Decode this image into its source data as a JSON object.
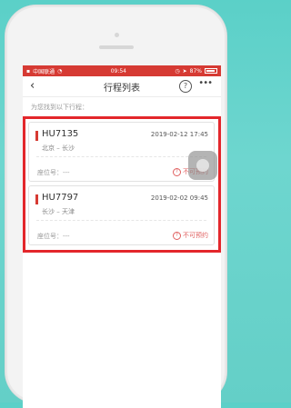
{
  "status_bar": {
    "carrier": "中国联通",
    "time": "09:54",
    "battery": "87%",
    "battery_level": 0.87
  },
  "nav": {
    "back_icon": "chevron-left-icon",
    "title": "行程列表",
    "help_icon": "help-circle-icon",
    "more_icon": "more-dots-icon"
  },
  "hint": "为您找到以下行程：",
  "trips": [
    {
      "flight": "HU7135",
      "datetime": "2019-02-12 17:45",
      "route": "北京 – 长沙",
      "seat": "座位号：---",
      "status": "不可预约"
    },
    {
      "flight": "HU7797",
      "datetime": "2019-02-02 09:45",
      "route": "长沙 – 天津",
      "seat": "座位号：---",
      "status": "不可预约"
    }
  ],
  "colors": {
    "accent": "#d63a33",
    "highlight": "#e3262b"
  }
}
